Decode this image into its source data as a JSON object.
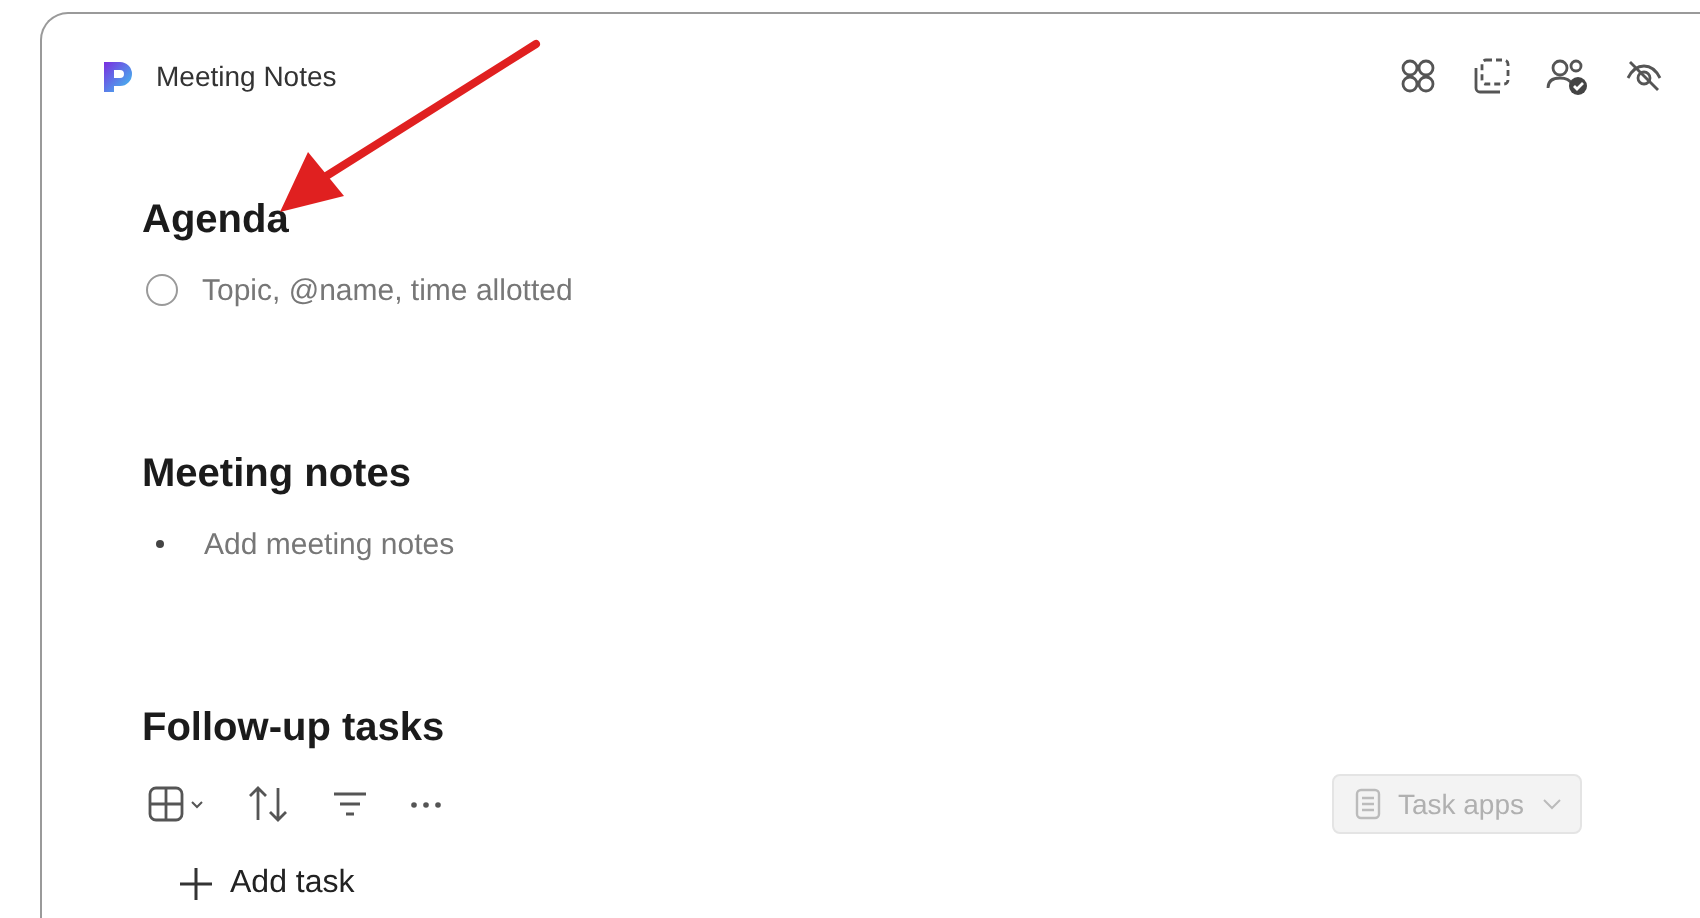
{
  "window": {
    "title": "Meeting Notes"
  },
  "sections": [
    {
      "heading": "Agenda",
      "kind": "checklist",
      "items": [
        {
          "placeholder": "Topic, @name, time allotted",
          "checked": false
        }
      ]
    },
    {
      "heading": "Meeting notes",
      "kind": "bullets",
      "items": [
        {
          "placeholder": "Add meeting notes"
        }
      ]
    },
    {
      "heading": "Follow-up tasks",
      "kind": "tasks",
      "task_apps": {
        "label": "Task apps",
        "disabled": true
      },
      "add_task": "Add task"
    }
  ]
}
